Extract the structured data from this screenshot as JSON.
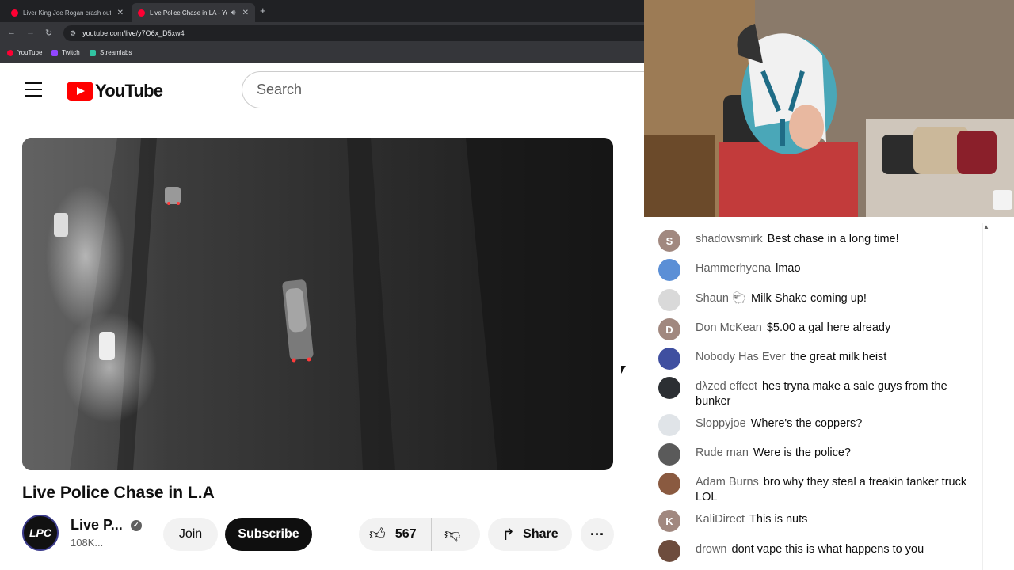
{
  "browser": {
    "tabs": [
      {
        "label": "Liver King Joe Rogan crash out",
        "active": false
      },
      {
        "label": "Live Police Chase in LA - Yo",
        "active": true
      }
    ],
    "new_tab": "+",
    "url": "youtube.com/live/y7O6x_D5xw4",
    "bookmarks": [
      {
        "label": "YouTube",
        "color": "#ff0033"
      },
      {
        "label": "Twitch",
        "color": "#9146ff"
      },
      {
        "label": "Streamlabs",
        "color": "#31c3a2"
      }
    ]
  },
  "youtube": {
    "logo_text": "YouTube",
    "search_placeholder": "Search",
    "video_title": "Live Police Chase in L.A",
    "channel": {
      "avatar_text": "LPC",
      "name": "Live P...",
      "subscribers": "108K..."
    },
    "buttons": {
      "join": "Join",
      "subscribe": "Subscribe",
      "like_count": "567",
      "share": "Share",
      "more": "···"
    }
  },
  "chat": {
    "messages": [
      {
        "author": "shadowsmirk",
        "text": "Best chase in a long time!",
        "avatar": "S",
        "color": "#a1887f"
      },
      {
        "author": "Hammerhyena",
        "text": "lmao",
        "avatar": "",
        "color": "#5b8fd6"
      },
      {
        "author": "Shaun 🐑",
        "text": "Milk Shake coming up!",
        "avatar": "",
        "color": "#d9d9d9"
      },
      {
        "author": "Don McKean",
        "text": "$5.00 a gal here already",
        "avatar": "D",
        "color": "#a1887f"
      },
      {
        "author": "Nobody Has Ever",
        "text": "the great milk heist",
        "avatar": "",
        "color": "#3f4fa0"
      },
      {
        "author": "dλzed effect",
        "text": "hes tryna make a sale guys from the bunker",
        "avatar": "",
        "color": "#2c2f33"
      },
      {
        "author": "Sloppyjoe",
        "text": "Where's the coppers?",
        "avatar": "",
        "color": "#e0e4e8"
      },
      {
        "author": "Rude man",
        "text": "Were is the police?",
        "avatar": "",
        "color": "#5a5a5a"
      },
      {
        "author": "Adam Burns",
        "text": "bro why they steal a freakin tanker truck LOL",
        "avatar": "",
        "color": "#8a5a40"
      },
      {
        "author": "KaliDirect",
        "text": "This is nuts",
        "avatar": "K",
        "color": "#a1887f"
      },
      {
        "author": "drown",
        "text": "dont vape this is what happens to you",
        "avatar": "",
        "color": "#6d4c3d"
      }
    ]
  }
}
